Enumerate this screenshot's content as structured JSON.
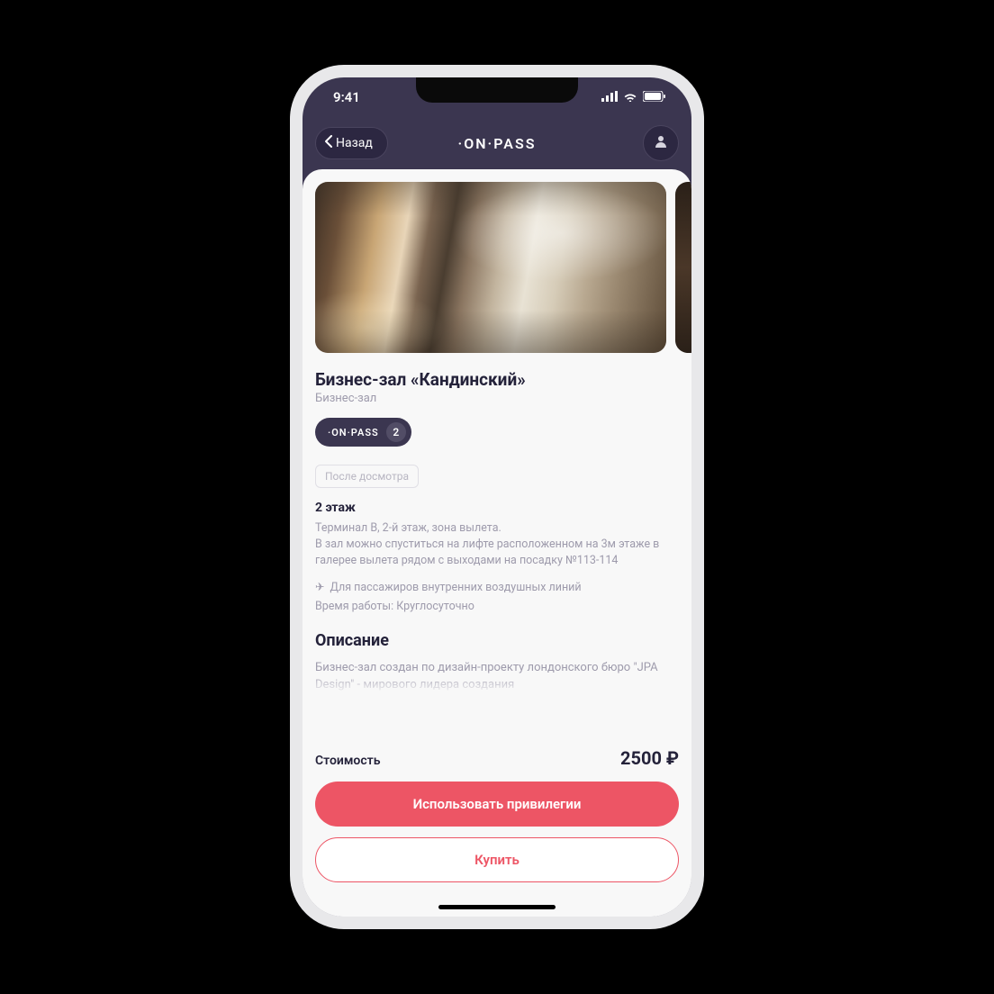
{
  "status": {
    "time": "9:41"
  },
  "nav": {
    "back_label": "Назад",
    "title": "·ON·PASS"
  },
  "lounge": {
    "title": "Бизнес-зал «Кандинский»",
    "subtitle": "Бизнес-зал",
    "badge": {
      "label": "·ON·PASS",
      "count": "2"
    },
    "tag": "После досмотра",
    "floor": "2 этаж",
    "location_text": "Терминал B, 2-й этаж, зона вылета.\nВ зал можно спуститься на лифте расположенном на 3м этаже в галерее вылета рядом с выходами на посадку №113-114",
    "passengers_note": "Для пассажиров внутренних воздушных линий",
    "hours": "Время работы: Круглосуточно",
    "description_heading": "Описание",
    "description_text": "Бизнес-зал создан по дизайн-проекту лондонского бюро \"JPA Design\" - мирового лидера создания"
  },
  "footer": {
    "price_label": "Стоимость",
    "price_value": "2500 ₽",
    "primary_button": "Использовать привилегии",
    "secondary_button": "Купить"
  }
}
